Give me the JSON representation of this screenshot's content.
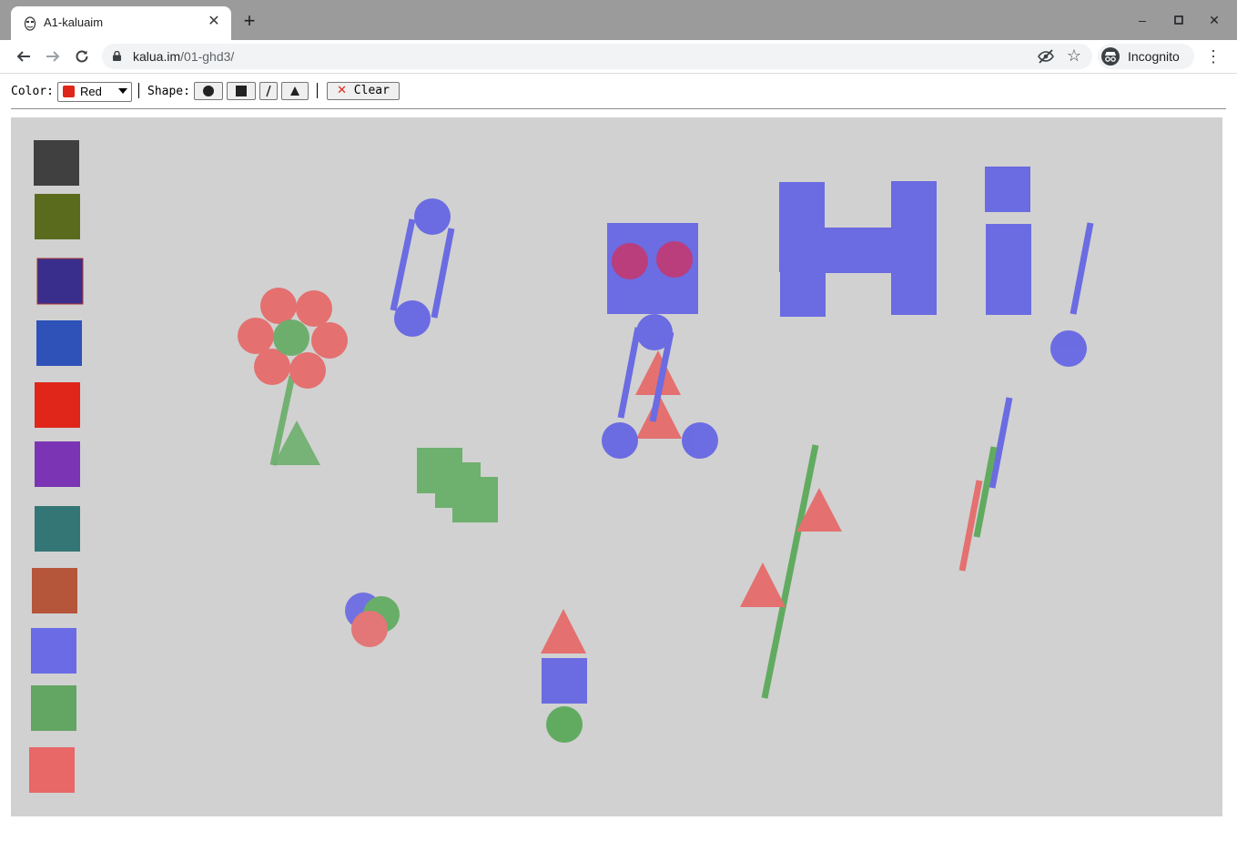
{
  "browser": {
    "tab_title": "A1-kaluaim",
    "url_host": "kalua.im",
    "url_path": "/01-ghd3/",
    "incognito_label": "Incognito",
    "icons": [
      "back-icon",
      "forward-icon",
      "reload-icon",
      "lock-icon",
      "eye-off-icon",
      "star-icon",
      "incognito-icon",
      "menu-icon",
      "new-tab-icon",
      "close-icon",
      "minimize-icon",
      "maximize-icon"
    ]
  },
  "controls": {
    "color_label": "Color:",
    "color_selected": "Red",
    "color_swatch": "#e0261a",
    "separator": "|",
    "shape_label": "Shape:",
    "shape_buttons": [
      "circle",
      "square",
      "line",
      "triangle"
    ],
    "clear_label": "Clear",
    "clear_icon": "cross-mark-icon"
  },
  "canvas": {
    "background": "#d1d1d1",
    "palette": [
      "#404040",
      "#5a6b1e",
      "#3a2e8c",
      "#2e52b8",
      "#e0261a",
      "#7b35b4",
      "#347676",
      "#b5553a",
      "#6b6be6",
      "#63a563",
      "#e86767"
    ],
    "shape_colors": {
      "blue": "#5a5ae6",
      "red": "#e86060",
      "green": "#5ca85c"
    }
  }
}
